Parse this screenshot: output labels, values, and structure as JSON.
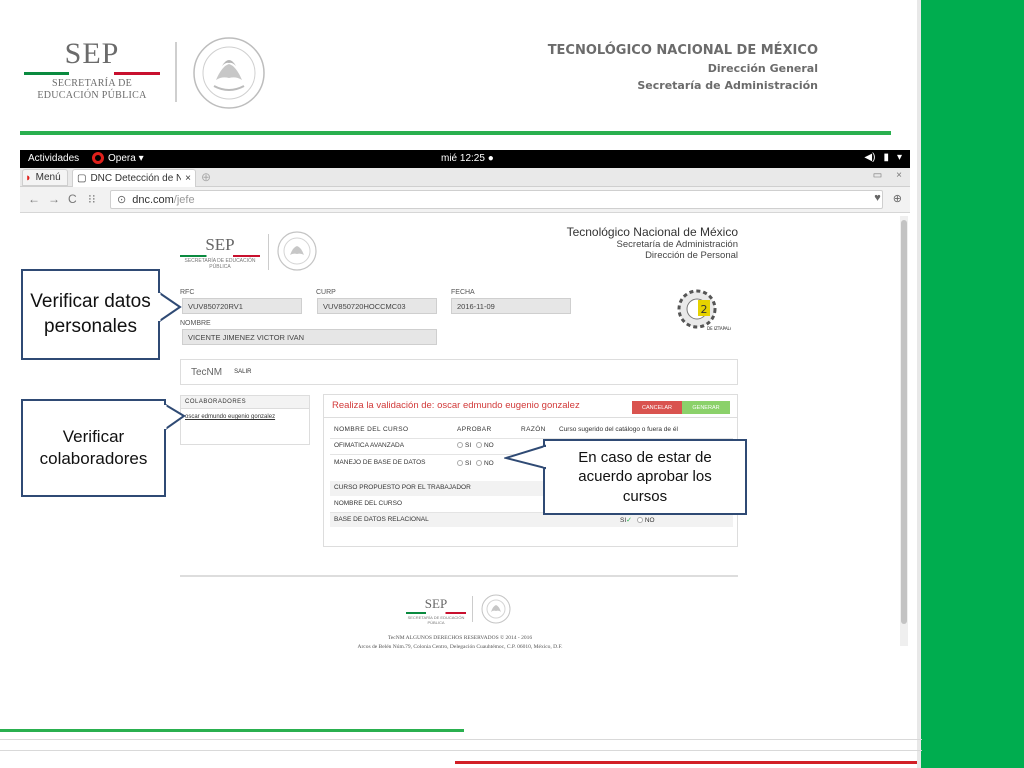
{
  "slide": {
    "sep_logo": {
      "word": "SEP",
      "line1": "SECRETARÍA DE",
      "line2": "EDUCACIÓN PÚBLICA"
    },
    "org": {
      "title": "TECNOLÓGICO NACIONAL DE MÉXICO",
      "subtitle1": "Dirección General",
      "subtitle2": "Secretaría de Administración"
    },
    "colors": {
      "green": "#00ad4f",
      "rule_green": "#2ab04f",
      "rule_red": "#d21f26",
      "callout_border": "#2f4a74"
    }
  },
  "browser": {
    "system_bar": {
      "activities": "Actividades",
      "app": "Opera ▾",
      "clock": "mié 12:25 ●",
      "icons": [
        "volume-icon",
        "battery-icon",
        "system-menu-icon"
      ]
    },
    "menu_button": "Menú",
    "tab": {
      "label": "DNC Detección de N",
      "close": "×"
    },
    "url": {
      "host": "dnc.com",
      "path": "/jefe"
    },
    "page": {
      "header": {
        "sep_word": "SEP",
        "sep_sub": "SECRETARÍA DE EDUCACIÓN PÚBLICA",
        "org_title": "Tecnológico Nacional de México",
        "org_sub1": "Secretaría de Administración",
        "org_sub2": "Dirección de Personal"
      },
      "form": {
        "rfc_label": "RFC",
        "rfc_value": "VUV850720RV1",
        "curp_label": "CURP",
        "curp_value": "VUV850720HOCCMC03",
        "fecha_label": "FECHA",
        "fecha_value": "2016-11-09",
        "nombre_label": "NOMBRE",
        "nombre_value": "VICENTE JIMENEZ VICTOR IVAN"
      },
      "institution_logo": {
        "text": "INSTITUTO TECNOLÓGICO DE IZTAPALAPA II",
        "badge": "2"
      },
      "tecnm_bar": {
        "brand": "TecNM",
        "salir": "SALIR"
      },
      "colaboradores": {
        "header": "COLABORADORES",
        "items": [
          "oscar edmundo eugenio gonzalez"
        ]
      },
      "validation": {
        "title": "Realiza la validación de: oscar edmundo eugenio gonzalez",
        "cancel": "CANCELAR",
        "generar": "GENERAR",
        "col_course": "NOMBRE DEL CURSO",
        "col_approve": "APROBAR",
        "col_reason": "RAZÓN",
        "col_suggested": "Curso sugerido del catálogo o fuera de él",
        "courses": [
          {
            "name": "OFIMATICA AVANZADA",
            "yes": "SI",
            "no": "NO"
          },
          {
            "name": "MANEJO DE BASE DE DATOS",
            "yes": "SI",
            "no": "NO"
          }
        ],
        "proposed_header": "CURSO PROPUESTO POR EL TRABAJADOR",
        "proposed_col": "NOMBRE DEL CURSO",
        "proposed_course": {
          "name": "BASE DE DATOS RELACIONAL",
          "yes": "SI",
          "no": "NO"
        }
      },
      "footer": {
        "sep_word": "SEP",
        "sep_sub": "SECRETARÍA DE EDUCACIÓN PÚBLICA",
        "line1": "TecNM ALGUNOS DERECHOS RESERVADOS © 2014 - 2016",
        "line2": "Arcos de Belén Núm.79, Colonia Centro, Delegación Cuauhtémoc, C.P. 06010, México, D.F."
      }
    }
  },
  "callouts": {
    "personal": "Verificar datos personales",
    "colaboradores": "Verificar colaboradores",
    "aprobar": "En caso de estar de acuerdo aprobar los cursos"
  }
}
